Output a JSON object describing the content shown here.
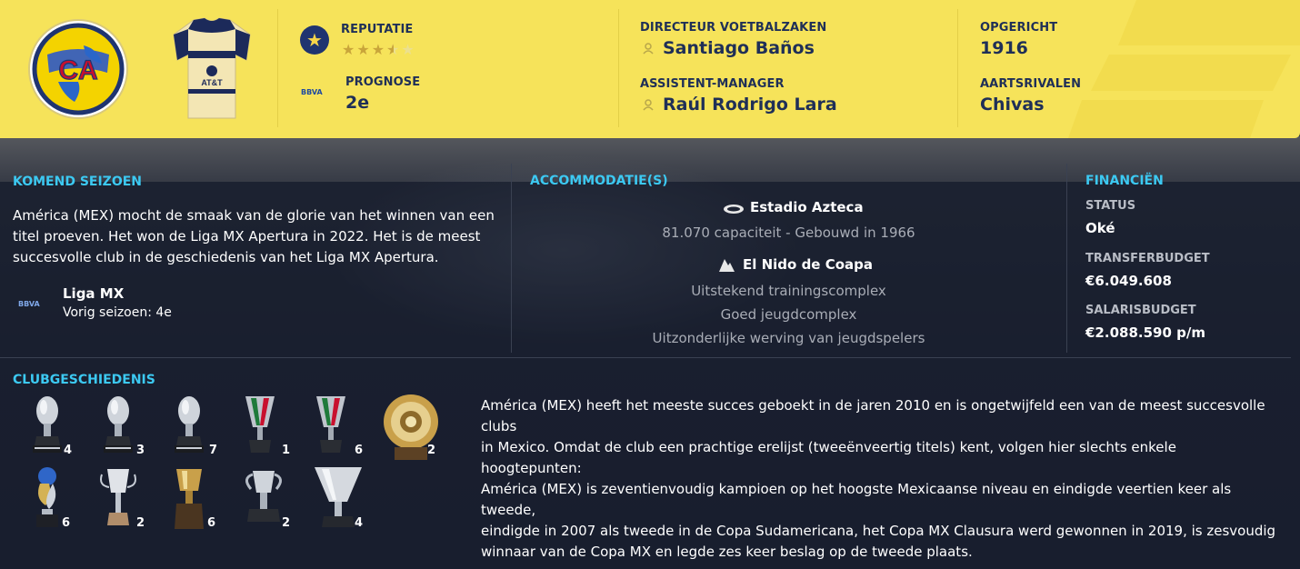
{
  "header": {
    "reputation": {
      "label": "REPUTATIE",
      "stars": 3.5,
      "max": 5
    },
    "forecast": {
      "label": "PROGNOSE",
      "value": "2e"
    },
    "director": {
      "label": "DIRECTEUR VOETBALZAKEN",
      "value": "Santiago Baños"
    },
    "assistant": {
      "label": "ASSISTENT-MANAGER",
      "value": "Raúl Rodrigo Lara"
    },
    "founded": {
      "label": "OPGERICHT",
      "value": "1916"
    },
    "rivals": {
      "label": "AARTSRIVALEN",
      "value": "Chivas"
    },
    "logo_text": "CA",
    "kit_text": "AT&T",
    "league_logo_text": "BBVA",
    "colors": {
      "header_bg": "#f6e35a",
      "header_text": "#1f2f57",
      "accent": "#3cc9f2"
    }
  },
  "next_season": {
    "title": "KOMEND SEIZOEN",
    "text_lines": [
      "América (MEX) mocht de smaak van de glorie van het winnen van een",
      "titel proeven. Het won de Liga MX Apertura in 2022. Het is de meest",
      "succesvolle club in de geschiedenis van het Liga MX Apertura."
    ],
    "league": {
      "name": "Liga MX",
      "last_season": "Vorig seizoen: 4e",
      "logo_text": "BBVA"
    }
  },
  "facilities": {
    "title": "ACCOMMODATIE(S)",
    "stadium": {
      "name": "Estadio Azteca",
      "capacity": "81.070 capaciteit",
      "sep": "-",
      "built": "Gebouwd in 1966"
    },
    "training": {
      "name": "El Nido de Coapa",
      "lines": [
        "Uitstekend trainingscomplex",
        "Goed jeugdcomplex",
        "Uitzonderlijke werving van jeugdspelers"
      ]
    }
  },
  "finances": {
    "title": "FINANCIËN",
    "status": {
      "label": "STATUS",
      "value": "Oké"
    },
    "transfer": {
      "label": "TRANSFERBUDGET",
      "value": "€6.049.608"
    },
    "salary": {
      "label": "SALARISBUDGET",
      "value": "€2.088.590 p/m"
    }
  },
  "history": {
    "title": "CLUBGESCHIEDENIS",
    "trophies": [
      {
        "type": "silver-cup",
        "count": "4"
      },
      {
        "type": "silver-cup",
        "count": "3"
      },
      {
        "type": "silver-cup",
        "count": "7"
      },
      {
        "type": "tricolor-cup",
        "count": "1"
      },
      {
        "type": "tricolor-cup",
        "count": "6"
      },
      {
        "type": "gold-plate",
        "count": "2"
      },
      {
        "type": "globe-trophy",
        "count": "6"
      },
      {
        "type": "tall-cup",
        "count": "2"
      },
      {
        "type": "gold-cup",
        "count": "6"
      },
      {
        "type": "handle-cup",
        "count": "2"
      },
      {
        "type": "wide-cup",
        "count": "4"
      }
    ],
    "text_lines": [
      "América (MEX) heeft het meeste succes geboekt in de jaren 2010 en is ongetwijfeld een van de meest succesvolle clubs",
      "in Mexico. Omdat de club een prachtige erelijst (tweeënveertig titels) kent, volgen hier slechts enkele hoogtepunten:",
      "América (MEX) is zeventienvoudig kampioen op het hoogste Mexicaanse niveau en eindigde veertien keer als tweede,",
      "eindigde in 2007 als tweede in de Copa Sudamericana, het Copa MX Clausura werd gewonnen in 2019, is zesvoudig",
      "winnaar van de Copa MX en legde zes keer beslag op de tweede plaats."
    ]
  }
}
